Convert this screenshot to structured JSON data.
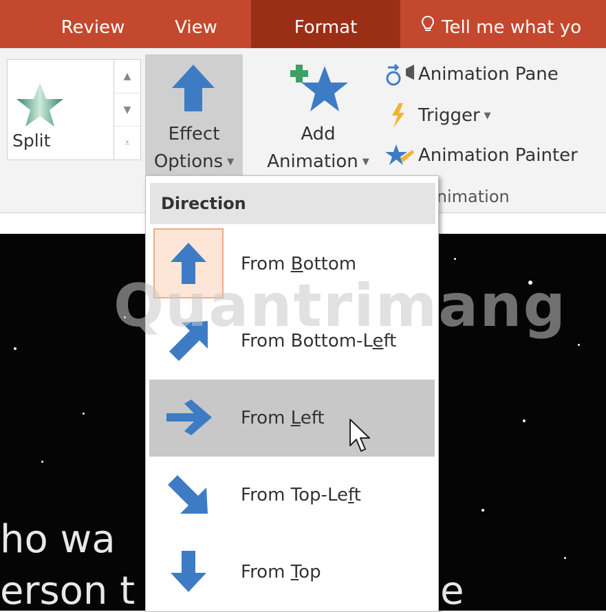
{
  "tabs": [
    {
      "label": "Review",
      "active": false
    },
    {
      "label": "View",
      "active": false
    },
    {
      "label": "Format",
      "active": true
    },
    {
      "label": "Tell me what yo",
      "active": false,
      "icon": "lightbulb-icon"
    }
  ],
  "ribbon": {
    "gallery": {
      "selected_effect": "Split"
    },
    "effect_options": {
      "line1": "Effect",
      "line2": "Options"
    },
    "add_animation": {
      "line1": "Add",
      "line2": "Animation"
    },
    "side_items": [
      {
        "label": "Animation Pane",
        "icon": "animation-pane-icon"
      },
      {
        "label": "Trigger",
        "icon": "lightning-icon",
        "has_dropdown": true
      },
      {
        "label": "Animation Painter",
        "icon": "animation-painter-icon"
      }
    ],
    "group_label": " nimation"
  },
  "dropdown": {
    "header": "Direction",
    "items": [
      {
        "pre": "From ",
        "u": "B",
        "post": "ottom",
        "icon": "arrow-up-icon",
        "state": "selected"
      },
      {
        "pre": "From Bottom-L",
        "u": "e",
        "post": "ft",
        "icon": "arrow-up-right-icon",
        "state": "normal"
      },
      {
        "pre": "From ",
        "u": "L",
        "post": "eft",
        "icon": "arrow-right-icon",
        "state": "hover"
      },
      {
        "pre": "From Top-Le",
        "u": "f",
        "post": "t",
        "icon": "arrow-down-right-icon",
        "state": "normal"
      },
      {
        "pre": "From ",
        "u": "T",
        "post": "op",
        "icon": "arrow-down-icon",
        "state": "normal"
      }
    ]
  },
  "slide": {
    "line1": "ho wa",
    "line2": "erson t",
    "trailing_char": "e"
  },
  "watermark": "Quantrimang",
  "colors": {
    "tab_bar": "#c4482d",
    "tab_active": "#9b2f16",
    "arrow_blue": "#3d7cc5",
    "hover_gray": "#c8c8c8",
    "selected_border": "#f0a987"
  }
}
